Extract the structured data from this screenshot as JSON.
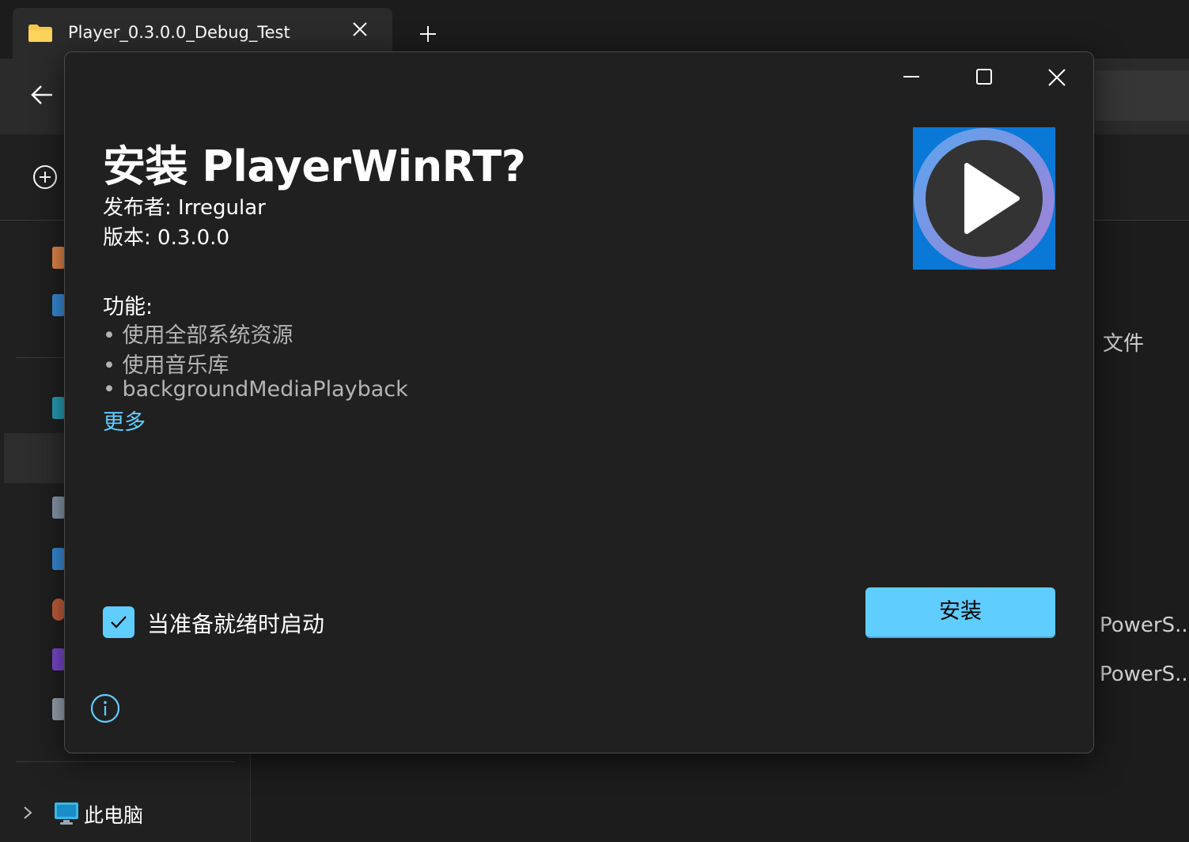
{
  "explorer": {
    "tab": {
      "title": "Player_0.3.0.0_Debug_Test"
    },
    "sidebar": {
      "this_pc_label": "此电脑"
    },
    "content": {
      "fragment_1": "文件",
      "fragment_2": "PowerS...",
      "fragment_3": "PowerS..."
    }
  },
  "dialog": {
    "title": "安装 PlayerWinRT?",
    "publisher": "发布者: Irregular",
    "version": "版本: 0.3.0.0",
    "capabilities_header": "功能:",
    "capabilities": [
      "• 使用全部系统资源",
      "• 使用音乐库",
      "• backgroundMediaPlayback"
    ],
    "more_link": "更多",
    "launch_checkbox": {
      "label": "当准备就绪时启动",
      "checked": true
    },
    "install_button": "安装"
  },
  "colors": {
    "accent": "#60cdff",
    "dialog_bg": "#202020",
    "logo_bg": "#0a78d7"
  }
}
